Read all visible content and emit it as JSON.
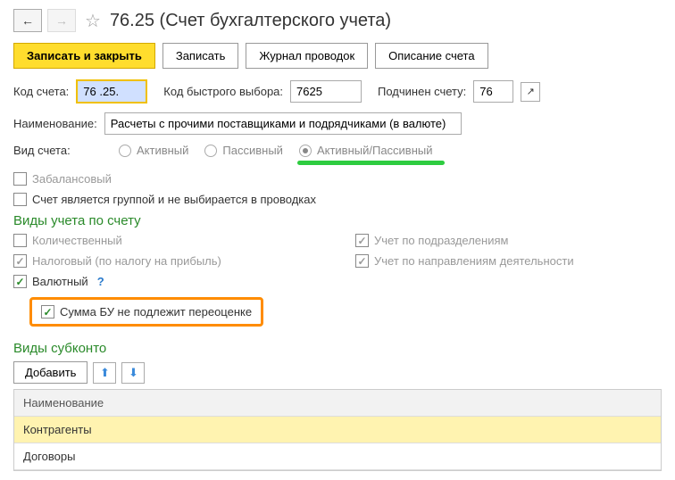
{
  "header": {
    "title": "76.25 (Счет бухгалтерского учета)"
  },
  "toolbar": {
    "save_close": "Записать и закрыть",
    "save": "Записать",
    "journal": "Журнал проводок",
    "description": "Описание счета"
  },
  "form": {
    "code_label": "Код счета:",
    "code_value": "76 .25.",
    "quick_label": "Код быстрого выбора:",
    "quick_value": "7625",
    "parent_label": "Подчинен счету:",
    "parent_value": "76",
    "name_label": "Наименование:",
    "name_value": "Расчеты с прочими поставщиками и подрядчиками (в валюте)",
    "type_label": "Вид счета:",
    "type_active": "Активный",
    "type_passive": "Пассивный",
    "type_both": "Активный/Пассивный",
    "offbalance": "Забалансовый",
    "is_group": "Счет является группой и не выбирается в проводках"
  },
  "accounting": {
    "section": "Виды учета по счету",
    "qty": "Количественный",
    "tax": "Налоговый (по налогу на прибыль)",
    "divisions": "Учет по подразделениям",
    "directions": "Учет по направлениям деятельности",
    "currency": "Валютный",
    "no_reval": "Сумма БУ не подлежит переоценке"
  },
  "subkonto": {
    "section": "Виды субконто",
    "add": "Добавить",
    "header": "Наименование",
    "rows": [
      "Контрагенты",
      "Договоры"
    ]
  }
}
